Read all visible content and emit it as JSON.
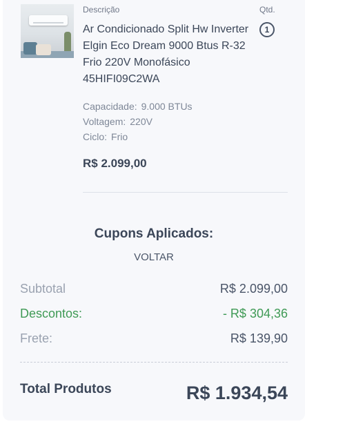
{
  "cart": {
    "description_label": "Descrição",
    "qty_label": "Qtd.",
    "item": {
      "image_icon": "air-conditioner-product-photo",
      "title": "Ar Condicionado Split Hw Inverter Elgin Eco Dream 9000 Btus R-32 Frio 220V Monofásico 45HIFI09C2WA",
      "quantity": "1",
      "specs": [
        {
          "label": "Capacidade:",
          "value": "9.000 BTUs"
        },
        {
          "label": "Voltagem:",
          "value": "220V"
        },
        {
          "label": "Ciclo:",
          "value": "Frio"
        }
      ],
      "price": "R$ 2.099,00"
    }
  },
  "coupons": {
    "title": "Cupons Aplicados:",
    "code": "VOLTAR"
  },
  "summary": {
    "subtotal_label": "Subtotal",
    "subtotal_value": "R$ 2.099,00",
    "discount_label": "Descontos:",
    "discount_value": "- R$ 304,36",
    "shipping_label": "Frete:",
    "shipping_value": "R$ 139,90",
    "total_label": "Total Produtos",
    "total_value": "R$ 1.934,54"
  },
  "colors": {
    "primary_text": "#3b4658",
    "muted_text": "#9aa2b0",
    "discount_green": "#3f9a55",
    "card_background": "#f7f8fb"
  }
}
